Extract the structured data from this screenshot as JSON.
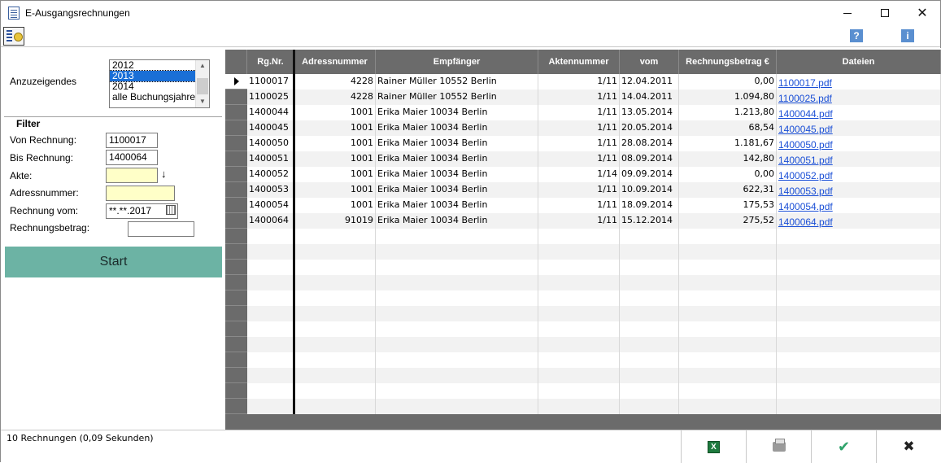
{
  "window": {
    "title": "E-Ausgangsrechnungen"
  },
  "left": {
    "anzuzeigendes_label": "Anzuzeigendes",
    "years": [
      "2012",
      "2013",
      "2014",
      "alle Buchungsjahre"
    ],
    "selected_year": "2013",
    "filter_title": "Filter",
    "von_label": "Von Rechnung:",
    "von_value": "1100017",
    "bis_label": "Bis Rechnung:",
    "bis_value": "1400064",
    "akte_label": "Akte:",
    "akte_value": "",
    "adress_label": "Adressnummer:",
    "adress_value": "",
    "vom_label": "Rechnung vom:",
    "vom_value": "**.**.2017",
    "betrag_label": "Rechnungsbetrag:",
    "betrag_value": "",
    "start_label": "Start"
  },
  "grid": {
    "columns": [
      "Rg.Nr.",
      "Adressnummer",
      "Empfänger",
      "Aktennummer",
      "vom",
      "Rechnungsbetrag €",
      "Dateien"
    ],
    "rows": [
      [
        "1100017",
        "4228",
        "Rainer Müller 10552 Berlin",
        "1/11",
        "12.04.2011",
        "0,00",
        "1100017.pdf"
      ],
      [
        "1100025",
        "4228",
        "Rainer Müller 10552 Berlin",
        "1/11",
        "14.04.2011",
        "1.094,80",
        "1100025.pdf"
      ],
      [
        "1400044",
        "1001",
        "Erika Maier 10034 Berlin",
        "1/11",
        "13.05.2014",
        "1.213,80",
        "1400044.pdf"
      ],
      [
        "1400045",
        "1001",
        "Erika Maier 10034 Berlin",
        "1/11",
        "20.05.2014",
        "68,54",
        "1400045.pdf"
      ],
      [
        "1400050",
        "1001",
        "Erika Maier 10034 Berlin",
        "1/11",
        "28.08.2014",
        "1.181,67",
        "1400050.pdf"
      ],
      [
        "1400051",
        "1001",
        "Erika Maier 10034 Berlin",
        "1/11",
        "08.09.2014",
        "142,80",
        "1400051.pdf"
      ],
      [
        "1400052",
        "1001",
        "Erika Maier 10034 Berlin",
        "1/14",
        "09.09.2014",
        "0,00",
        "1400052.pdf"
      ],
      [
        "1400053",
        "1001",
        "Erika Maier 10034 Berlin",
        "1/11",
        "10.09.2014",
        "622,31",
        "1400053.pdf"
      ],
      [
        "1400054",
        "1001",
        "Erika Maier 10034 Berlin",
        "1/11",
        "18.09.2014",
        "175,53",
        "1400054.pdf"
      ],
      [
        "1400064",
        "91019",
        "Erika Maier 10034 Berlin",
        "1/11",
        "15.12.2014",
        "275,52",
        "1400064.pdf"
      ]
    ]
  },
  "status": {
    "text": "10 Rechnungen (0,09 Sekunden)"
  },
  "icons": {
    "help": "help-icon",
    "info": "info-icon",
    "excel": "excel-icon",
    "print": "print-icon",
    "check": "check-icon",
    "close": "close-icon"
  }
}
